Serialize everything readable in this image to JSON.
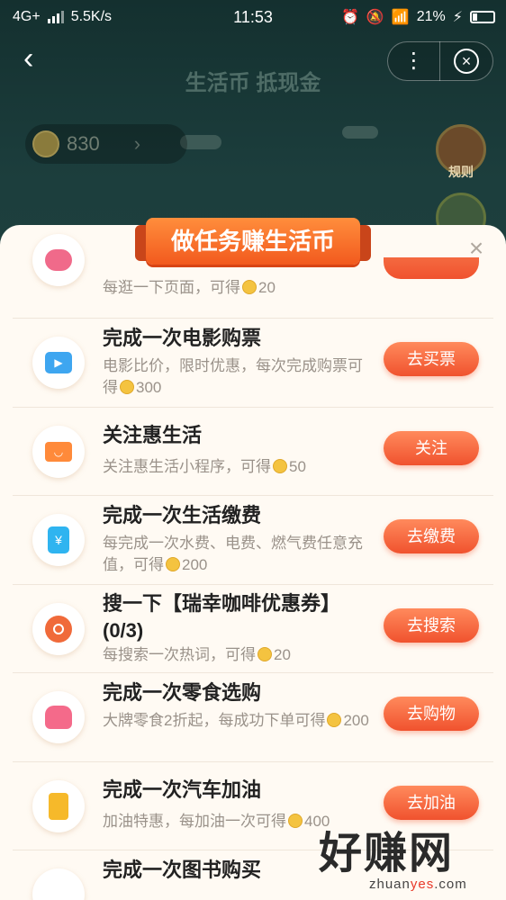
{
  "status_bar": {
    "network": "4G+",
    "speed": "5.5K/s",
    "time": "11:53",
    "battery": "21%"
  },
  "nav": {
    "title": "生活币 抵现金"
  },
  "coin_balance": "830",
  "rules_label": "规则",
  "panel": {
    "title": "做任务赚生活币",
    "close": "×"
  },
  "tasks": [
    {
      "title": "",
      "desc": "每逛一下页面，可得",
      "reward": "20",
      "button": ""
    },
    {
      "title": "完成一次电影购票",
      "desc": "电影比价，限时优惠，每次完成购票可得",
      "reward": "300",
      "button": "去买票"
    },
    {
      "title": "关注惠生活",
      "desc": "关注惠生活小程序，可得",
      "reward": "50",
      "button": "关注"
    },
    {
      "title": "完成一次生活缴费",
      "desc": "每完成一次水费、电费、燃气费任意充值，可得",
      "reward": "200",
      "button": "去缴费"
    },
    {
      "title": "搜一下【瑞幸咖啡优惠券】(0/3)",
      "desc": "每搜索一次热词，可得",
      "reward": "20",
      "button": "去搜索"
    },
    {
      "title": "完成一次零食选购",
      "desc": "大牌零食2折起，每成功下单可得",
      "reward": "200",
      "button": "去购物"
    },
    {
      "title": "完成一次汽车加油",
      "desc": "加油特惠，每加油一次可得",
      "reward": "400",
      "button": "去加油"
    },
    {
      "title": "完成一次图书购买",
      "desc": "",
      "reward": "",
      "button": ""
    }
  ],
  "watermark": {
    "big": "好赚网",
    "small_a": "zhuan",
    "small_b": "yes",
    "small_c": ".com"
  },
  "colors": {
    "accent": "#f0522e",
    "panel_bg": "#fffaf3",
    "coin": "#f4c340"
  }
}
